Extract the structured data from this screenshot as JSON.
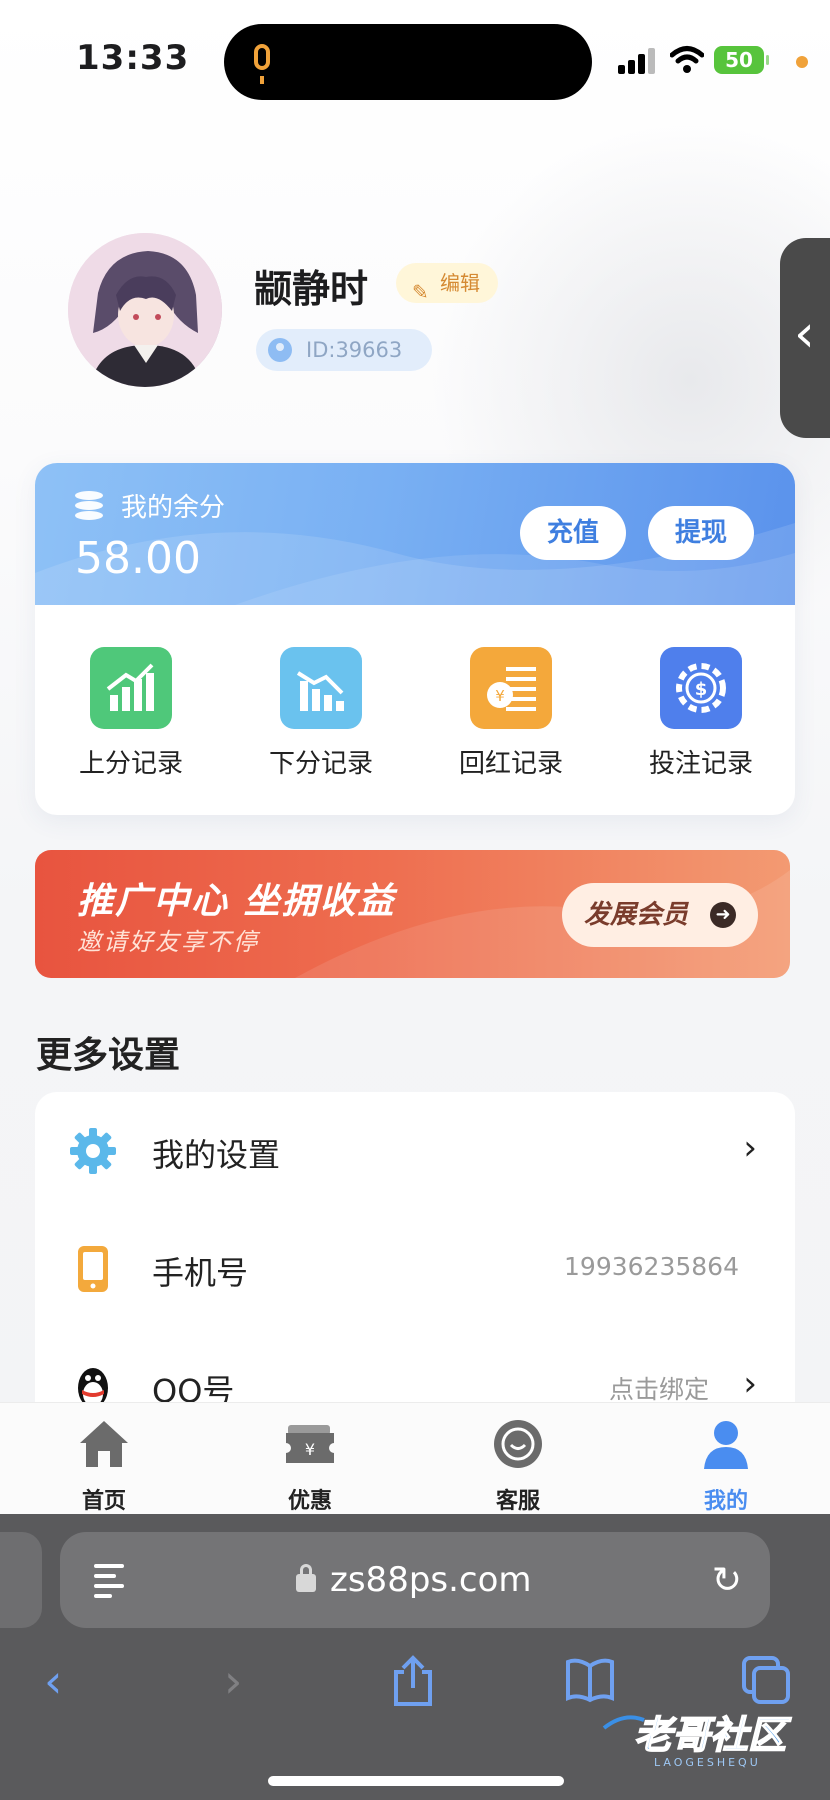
{
  "status_bar": {
    "time": "13:33",
    "battery": "50",
    "mic_indicator_icon": "microphone-icon",
    "accent_orange": "#f0a23a"
  },
  "profile": {
    "username": "颛静时",
    "edit_label": "编辑",
    "id_label": "ID:39663"
  },
  "balance": {
    "label": "我的余分",
    "value": "58.00",
    "recharge_label": "充值",
    "withdraw_label": "提现",
    "records": [
      {
        "label": "上分记录",
        "icon": "chart-up-icon",
        "color": "#4fc87a"
      },
      {
        "label": "下分记录",
        "icon": "chart-down-icon",
        "color": "#6ac2ee"
      },
      {
        "label": "回红记录",
        "icon": "coin-list-icon",
        "color": "#f4a83b"
      },
      {
        "label": "投注记录",
        "icon": "chip-icon",
        "color": "#4f7fec"
      }
    ]
  },
  "promo": {
    "title": "推广中心 坐拥收益",
    "subtitle": "邀请好友享不停",
    "button_label": "发展会员"
  },
  "settings": {
    "section_title": "更多设置",
    "rows": [
      {
        "label": "我的设置",
        "value": "",
        "icon": "gear-icon"
      },
      {
        "label": "手机号",
        "value": "19936235864",
        "icon": "phone-icon"
      },
      {
        "label": "QQ号",
        "value": "点击绑定",
        "icon": "qq-penguin-icon"
      }
    ]
  },
  "tab_bar": {
    "tabs": [
      {
        "label": "首页",
        "icon": "home-icon",
        "active": false
      },
      {
        "label": "优惠",
        "icon": "coupon-icon",
        "active": false
      },
      {
        "label": "客服",
        "icon": "chat-icon",
        "active": false
      },
      {
        "label": "我的",
        "icon": "user-icon",
        "active": true
      }
    ],
    "active_color": "#4a8df0"
  },
  "browser": {
    "url": "zs88ps.com"
  },
  "watermark": {
    "text": "老哥社区",
    "subtext": "LAOGESHEQU"
  }
}
